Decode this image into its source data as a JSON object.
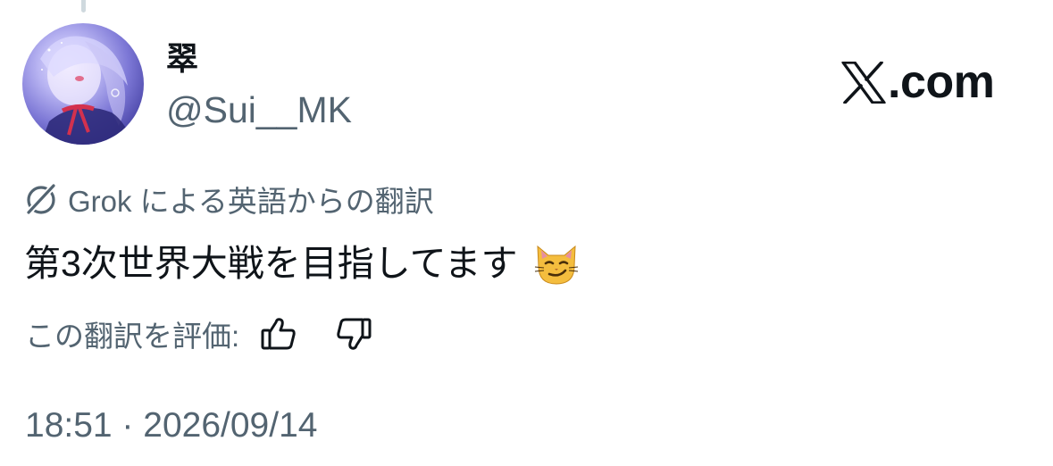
{
  "author": {
    "display_name": "翠",
    "handle": "@Sui__MK"
  },
  "brand": {
    "text": ".com"
  },
  "translation": {
    "label": "Grok による英語からの翻訳"
  },
  "tweet": {
    "text": "第3次世界大戦を目指してます",
    "emoji": "smirking-cat-emoji"
  },
  "rating": {
    "label": "この翻訳を評価:"
  },
  "timestamp": "18:51 · 2026/09/14",
  "colors": {
    "primary_text": "#0f1419",
    "secondary_text": "#536471",
    "thread_line": "#cfd9de"
  }
}
